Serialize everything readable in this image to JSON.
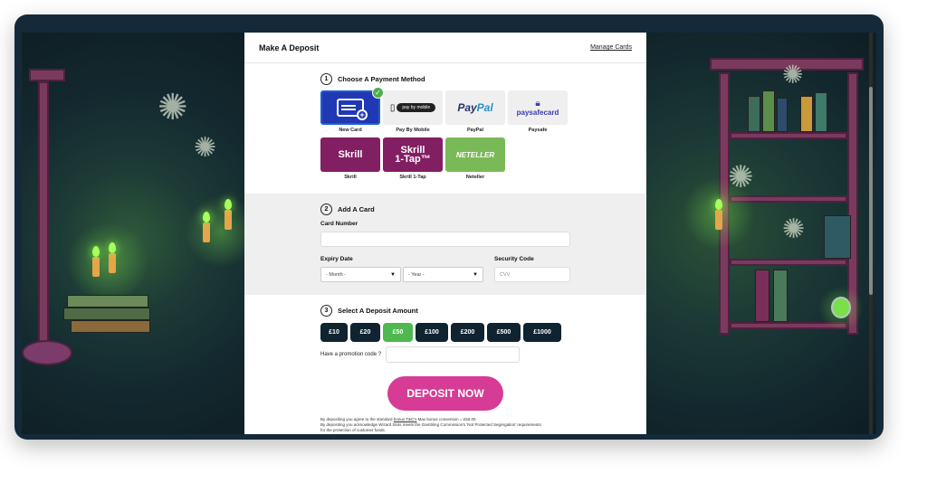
{
  "modal": {
    "title": "Make A Deposit",
    "manage_cards": "Manage Cards"
  },
  "step1": {
    "number": "1",
    "title": "Choose A Payment Method",
    "methods": [
      {
        "label": "New Card",
        "icon": "credit-card-plus-icon",
        "selected": true
      },
      {
        "label": "Pay By Mobile",
        "logo": "pay by mobile"
      },
      {
        "label": "PayPal",
        "logo_a": "Pay",
        "logo_b": "Pal"
      },
      {
        "label": "Paysafe",
        "logo": "paysafecard"
      },
      {
        "label": "Skrill",
        "logo": "Skrill"
      },
      {
        "label": "Skrill 1-Tap",
        "logo_a": "Skrill",
        "logo_b": "1-Tap™"
      },
      {
        "label": "Neteller",
        "logo": "NETELLER"
      }
    ]
  },
  "step2": {
    "number": "2",
    "title": "Add A Card",
    "card_number_label": "Card Number",
    "expiry_label": "Expiry Date",
    "month_value": "- Month -",
    "year_value": "- Year -",
    "security_label": "Security Code",
    "cvv_placeholder": "CVV"
  },
  "step3": {
    "number": "3",
    "title": "Select A Deposit Amount",
    "amounts": [
      "£10",
      "£20",
      "£50",
      "£100",
      "£200",
      "£500",
      "£1000"
    ],
    "selected_amount": "£50",
    "promo_label": "Have a promotion code ?"
  },
  "deposit_button": "DEPOSIT NOW",
  "fine_print": {
    "line1_a": "By depositing you agree to the standard",
    "line1_link": "bonus T&C's",
    "line1_b": "Max bonus conversion = £50.00",
    "line2": "By depositing you acknowledge Wizard Slots meets the Gambling Commission's 'Not Protected Segregation' requirements",
    "line3": "for the protection of customer funds."
  },
  "colors": {
    "accent_pink": "#d63c96",
    "selected_green": "#4fb84f",
    "amount_dark": "#0f2330",
    "new_card_blue": "#2138b4",
    "skrill_purple": "#821e62",
    "neteller_green": "#7ab957"
  }
}
